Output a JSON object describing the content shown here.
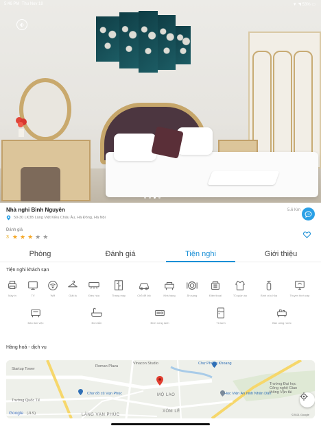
{
  "status_bar": {
    "time": "5:46 PM",
    "date": "Thu Nov 18",
    "battery": "53%"
  },
  "hero": {
    "image_dots": 4,
    "active_dot": 3
  },
  "hotel": {
    "name": "Nhà nghỉ Bình Nguyên",
    "address": "50-30 LK3B Làng Việt Kiều Châu Âu, Hà Đông, Hà Nội",
    "distance": "5.6 Km",
    "rating_label": "Đánh giá",
    "rating_value": "3",
    "stars": 3,
    "max_stars": 5
  },
  "tabs": [
    {
      "label": "Phòng",
      "active": false
    },
    {
      "label": "Đánh giá",
      "active": false
    },
    {
      "label": "Tiện nghi",
      "active": true
    },
    {
      "label": "Giới thiệu",
      "active": false
    }
  ],
  "amenities": {
    "title": "Tiện nghi khách sạn",
    "row1": [
      {
        "label": "Máy in",
        "icon": "printer-icon"
      },
      {
        "label": "TV",
        "icon": "tv-icon"
      },
      {
        "label": "Wifi",
        "icon": "wifi-icon"
      },
      {
        "label": "Giặt là",
        "icon": "hanger-icon"
      },
      {
        "label": "Điều hòa",
        "icon": "air-conditioner-icon"
      },
      {
        "label": "Thang máy",
        "icon": "elevator-icon"
      },
      {
        "label": "Chỗ để ôtô",
        "icon": "car-parking-icon"
      },
      {
        "label": "Nhà hàng",
        "icon": "restaurant-icon"
      },
      {
        "label": "Ăn sáng",
        "icon": "breakfast-icon"
      },
      {
        "label": "Điện thoại",
        "icon": "phone-icon"
      },
      {
        "label": "Tủ quần áo",
        "icon": "wardrobe-icon"
      },
      {
        "label": "Bình cứu hỏa",
        "icon": "fire-extinguisher-icon"
      },
      {
        "label": "Truyền hình cáp",
        "icon": "cable-tv-icon"
      }
    ],
    "row2": [
      {
        "label": "Bàn làm việc",
        "icon": "desk-icon"
      },
      {
        "label": "Bồn tắm",
        "icon": "bathtub-icon"
      },
      {
        "label": "Bình nóng lạnh",
        "icon": "water-heater-icon"
      },
      {
        "label": "Tủ lạnh",
        "icon": "fridge-icon"
      },
      {
        "label": "Bàn uống nước",
        "icon": "tea-table-icon"
      }
    ]
  },
  "services": {
    "title": "Hàng hoá - dịch vụ"
  },
  "map": {
    "labels": {
      "startup_tower": "Startup Tower",
      "roman_plaza": "Roman Plaza",
      "vinacon_studio": "Vinacon Studio",
      "cho_phung_khoang": "Chợ Phùng Khoang",
      "cho_van_phuc": "Chợ đồ cũ Vạn Phúc",
      "mo_lao": "MỘ LAO",
      "xom_le": "XÓM LỄ",
      "hoc_vien": "Học Viện An ninh Nhân Dân",
      "truong_dai_hoc": "Trường Đại học Công nghệ Giao thông Vận tải",
      "truong_quoc_te": "Trường Quốc Tế",
      "lang_van_phuc": "LÀNG VẠN PHÚC",
      "google": "Google",
      "copyright": "©2021 Google",
      "attribution_short": "(JLS)"
    }
  },
  "colors": {
    "accent": "#1a8fd6",
    "star": "#f5a623",
    "chat": "#2aa0e6",
    "map_pin": "#e23d2f"
  }
}
